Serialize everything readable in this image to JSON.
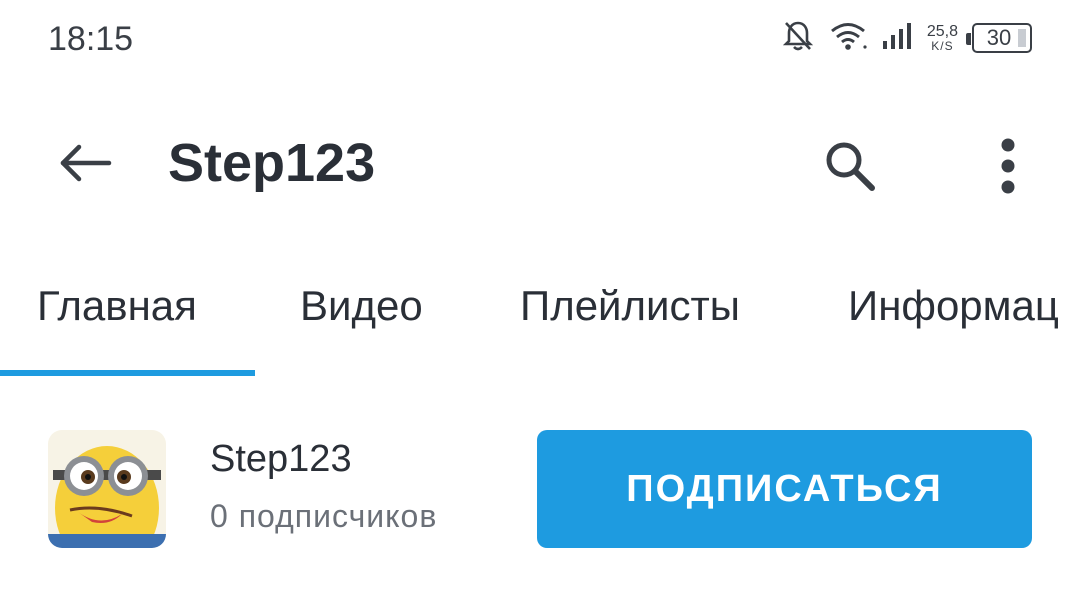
{
  "status_bar": {
    "time": "18:15",
    "icons": [
      "notifications-off-icon",
      "wifi-icon",
      "signal-icon"
    ],
    "net_speed_value": "25,8",
    "net_speed_unit": "K/S",
    "battery": "30"
  },
  "header": {
    "title": "Step123",
    "back_icon": "arrow-back-icon",
    "search_icon": "search-icon",
    "more_icon": "more-vert-icon"
  },
  "tabs": [
    {
      "label": "Главная",
      "active": true
    },
    {
      "label": "Видео",
      "active": false
    },
    {
      "label": "Плейлисты",
      "active": false
    },
    {
      "label": "Информац",
      "active": false
    }
  ],
  "channel": {
    "name": "Step123",
    "subscribers": "0 подписчиков",
    "subscribe_label": "ПОДПИСАТЬСЯ"
  },
  "colors": {
    "accent": "#1e9be0",
    "text": "#2a2f37",
    "secondary_text": "#6b7078",
    "background": "#ffffff"
  }
}
